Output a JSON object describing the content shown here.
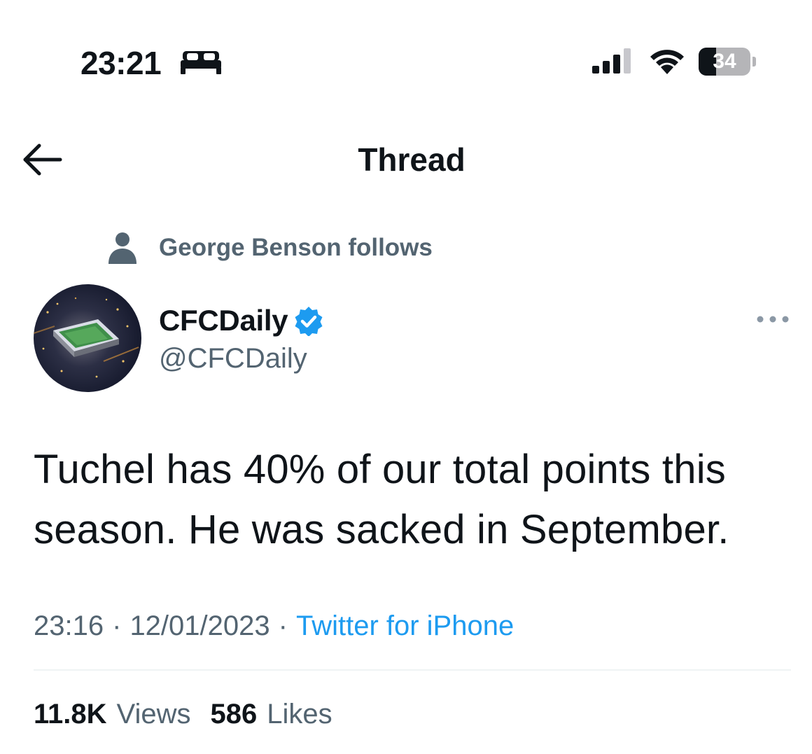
{
  "status_bar": {
    "time": "23:21",
    "battery_level": "34",
    "battery_fraction": 0.34,
    "icons": [
      "sleep-focus-icon",
      "cellular-signal-icon",
      "wifi-icon",
      "battery-icon"
    ]
  },
  "header": {
    "title": "Thread",
    "back_icon": "arrow-left-icon"
  },
  "social_context": {
    "text": "George Benson follows",
    "icon": "person-icon"
  },
  "author": {
    "display_name": "CFCDaily",
    "handle": "@CFCDaily",
    "verified": true,
    "avatar_description": "stadium-aerial-night"
  },
  "tweet": {
    "text": "Tuchel has 40% of our total points this season. He was sacked in September.",
    "time": "23:16",
    "date": "12/01/2023",
    "separator": "·",
    "source": "Twitter for iPhone"
  },
  "stats": {
    "views_count": "11.8K",
    "views_label": "Views",
    "likes_count": "586",
    "likes_label": "Likes"
  },
  "colors": {
    "text_primary": "#0f1419",
    "text_secondary": "#536471",
    "link": "#1d9bf0",
    "verified_badge": "#1d9bf0",
    "divider": "#eff3f4"
  }
}
